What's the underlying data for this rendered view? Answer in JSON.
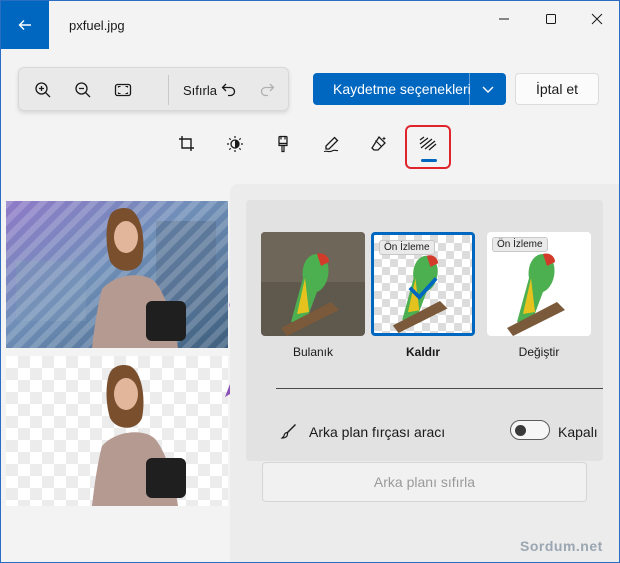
{
  "window": {
    "title": "pxfuel.jpg"
  },
  "toolbar": {
    "reset_label": "Sıfırla"
  },
  "actions": {
    "save_label": "Kaydetme seçenekleri",
    "cancel_label": "İptal et"
  },
  "edit_tools": [
    "crop-icon",
    "brightness-icon",
    "filter-brush-icon",
    "markup-pen-icon",
    "eraser-icon",
    "background-icon"
  ],
  "background_options": [
    {
      "label": "Bulanık",
      "selected": false
    },
    {
      "label": "Kaldır",
      "selected": true,
      "preview_tag": "Ön İzleme"
    },
    {
      "label": "Değiştir",
      "selected": false,
      "preview_tag": "Ön İzleme"
    }
  ],
  "brush": {
    "label": "Arka plan fırçası aracı",
    "toggle_state": "Kapalı"
  },
  "reset_background_label": "Arka planı sıfırla",
  "watermark": "Sordum.net",
  "colors": {
    "accent": "#0067c0",
    "highlight_box": "#e0242b",
    "arrow": "#8a4fb8"
  }
}
